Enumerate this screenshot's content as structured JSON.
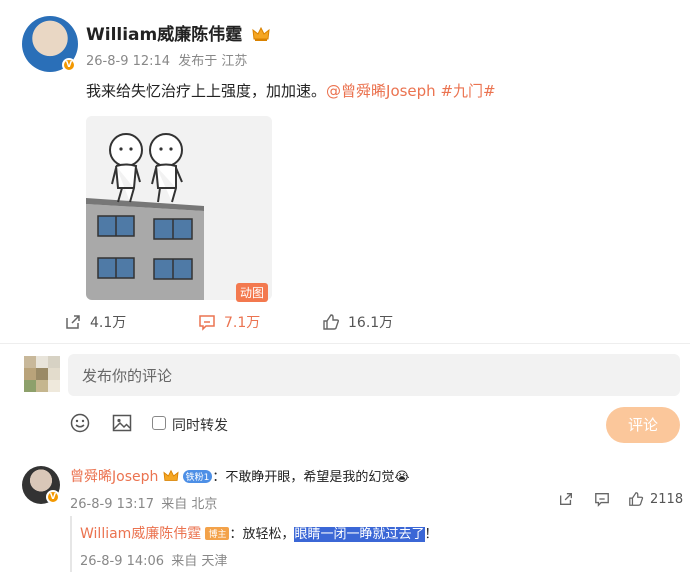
{
  "post": {
    "username": "William威廉陈伟霆",
    "time": "26-8-9 12:14",
    "source": "发布于 江苏",
    "text_main": "我来给失忆治疗上上强度，加加速。",
    "mention": "@曾舜晞Joseph",
    "hashtag": "#九门#",
    "gif_label": "动图",
    "reposts": "4.1万",
    "comments": "7.1万",
    "likes": "16.1万",
    "verified_badge": "V"
  },
  "compose": {
    "placeholder": "发布你的评论",
    "repost_label": "同时转发",
    "submit_label": "评论"
  },
  "comment": {
    "username": "曾舜晞Joseph",
    "fan_badge": "铁粉1",
    "text": "：不敢睁开眼，希望是我的幻觉😭",
    "time": "26-8-9 13:17",
    "location": "来自 北京",
    "like_count": "2118",
    "reply": {
      "username": "William威廉陈伟霆",
      "badge": "博主",
      "text_pre": "：放轻松，",
      "text_highlight": "眼睛一闭一睁就过去了",
      "text_post": "！",
      "time": "26-8-9 14:06",
      "location": "来自 天津"
    }
  },
  "colors": {
    "accent": "#eb7350",
    "submit_bg": "#fbc79b",
    "highlight": "#3b67d6"
  }
}
